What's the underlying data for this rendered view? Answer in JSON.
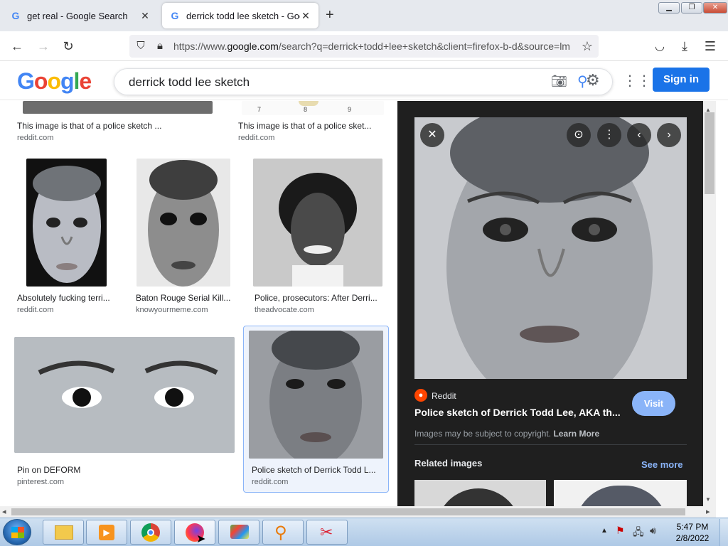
{
  "browser": {
    "tabs": [
      {
        "title": "get real - Google Search",
        "active": false
      },
      {
        "title": "derrick todd lee sketch - Google",
        "active": true
      }
    ],
    "url": {
      "prefix": "https://www.",
      "domain": "google.com",
      "rest": "/search?q=derrick+todd+lee+sketch&client=firefox-b-d&source=lm"
    }
  },
  "google": {
    "logo": "Google",
    "query": "derrick todd lee sketch",
    "signin_label": "Sign in"
  },
  "results": [
    {
      "caption": "This image is that of a police sketch ...",
      "source": "reddit.com"
    },
    {
      "caption": "This image is that of a police sket...",
      "source": "reddit.com"
    },
    {
      "caption": "Absolutely fucking terri...",
      "source": "reddit.com"
    },
    {
      "caption": "Baton Rouge Serial Kill...",
      "source": "knowyourmeme.com"
    },
    {
      "caption": "Police, prosecutors: After Derri...",
      "source": "theadvocate.com"
    },
    {
      "caption": "Pin on DEFORM",
      "source": "pinterest.com"
    },
    {
      "caption": "Police sketch of Derrick Todd L...",
      "source": "reddit.com"
    }
  ],
  "result_digits": [
    "7",
    "8",
    "9"
  ],
  "preview": {
    "site": "Reddit",
    "title": "Police sketch of Derrick Todd Lee, AKA th...",
    "visit_label": "Visit",
    "copyright": "Images may be subject to copyright.",
    "learn_more": "Learn More",
    "related_heading": "Related images",
    "see_more": "See more"
  },
  "taskbar": {
    "time": "5:47 PM",
    "date": "2/8/2022"
  },
  "colors": {
    "accent": "#1a73e8",
    "panel_bg": "#1f1f1f",
    "visit_btn": "#8ab4f8"
  }
}
